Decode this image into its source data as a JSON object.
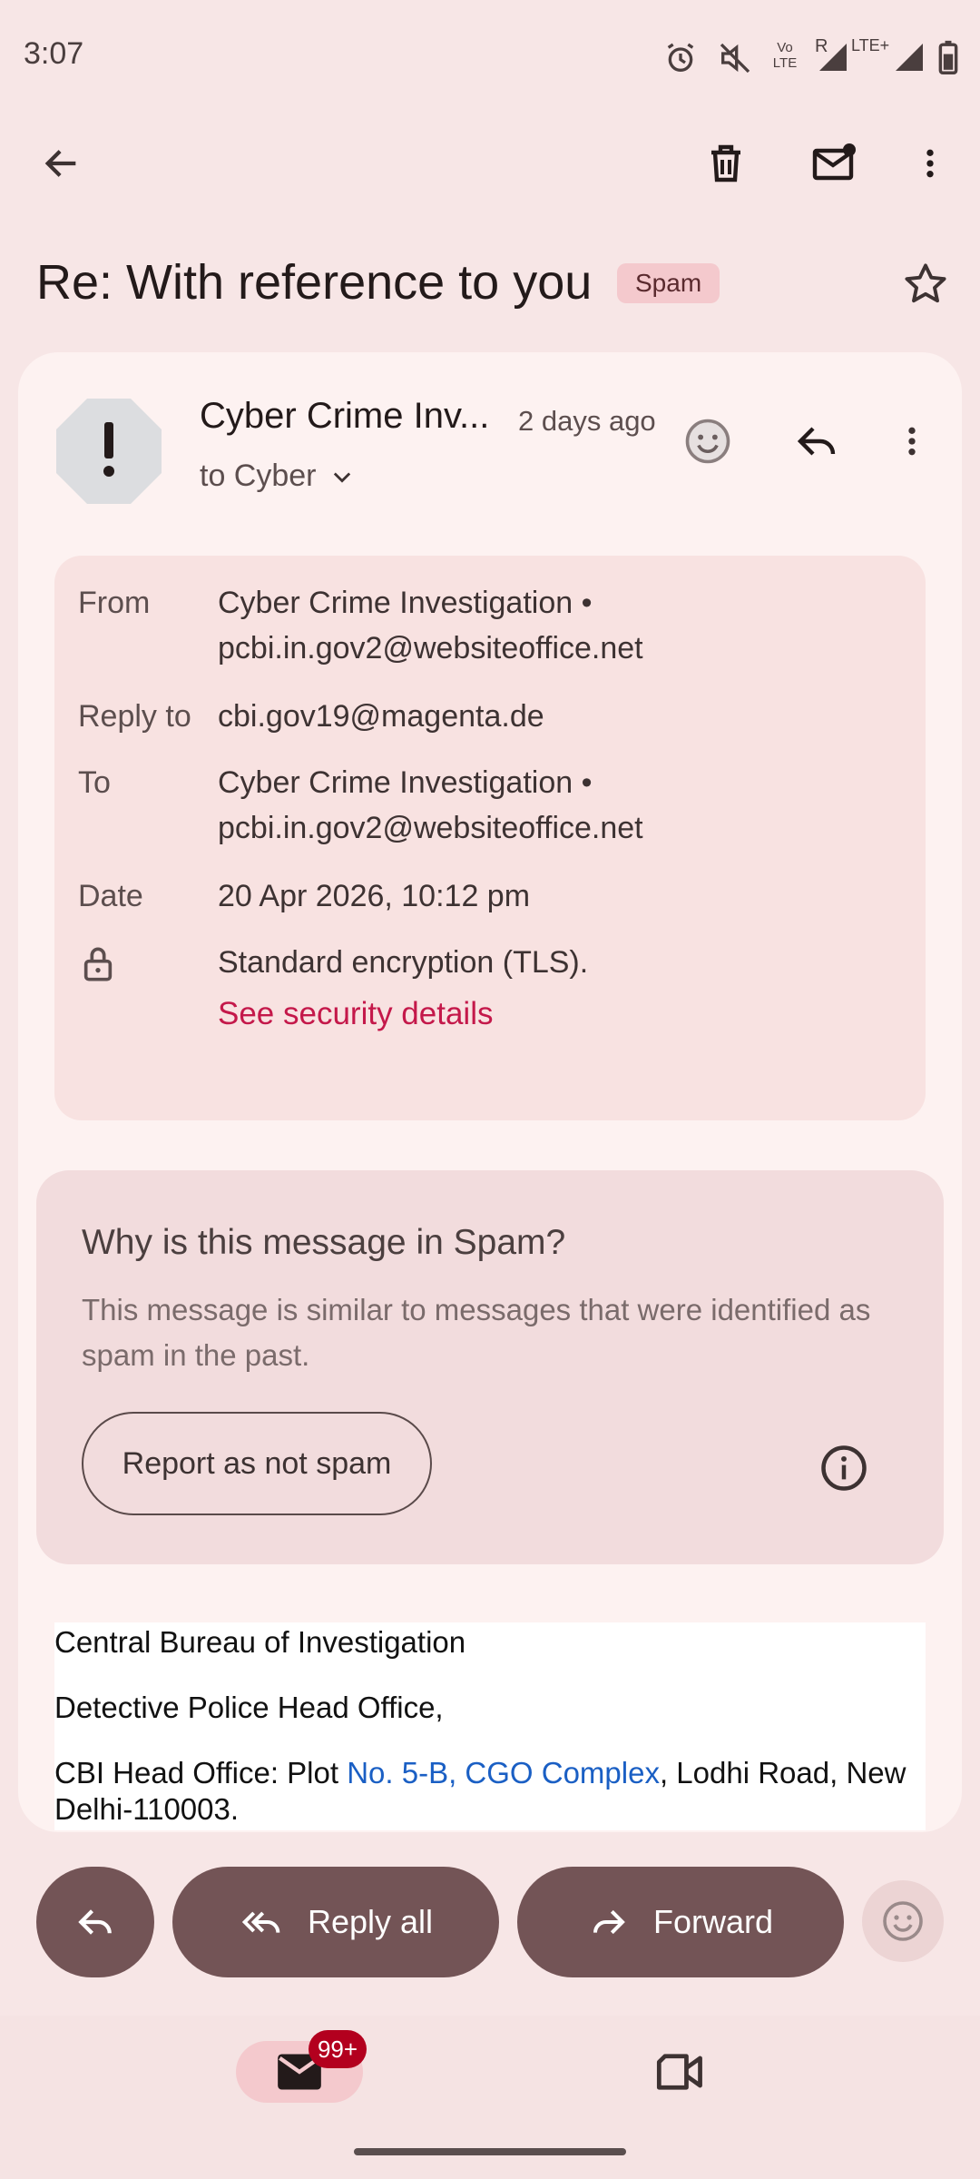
{
  "status_bar": {
    "time": "3:07",
    "network": "LTE+",
    "volte": "Vo LTE",
    "roaming": "R"
  },
  "toolbar": {
    "back": "arrow-left-icon",
    "delete": "trash-icon",
    "mark_unread": "mail-unread-icon",
    "more": "more-vert-icon"
  },
  "subject": {
    "text": "Re: With reference to you",
    "label": "Spam"
  },
  "message": {
    "sender_name": "Cyber Crime Inv...",
    "time": "2 days ago",
    "to": "to Cyber"
  },
  "details": {
    "from_label": "From",
    "from_name": "Cyber Crime Investigation •",
    "from_email": "pcbi.in.gov2@websiteoffice.net",
    "reply_to_label": "Reply to",
    "reply_to": "cbi.gov19@magenta.de",
    "to_label": "To",
    "to_name": "Cyber Crime Investigation •",
    "to_email": "pcbi.in.gov2@websiteoffice.net",
    "date_label": "Date",
    "date": "20 Apr 2026, 10:12 pm",
    "encryption": "Standard encryption (TLS).",
    "security_link": "See security details"
  },
  "spam_info": {
    "title": "Why is this message in Spam?",
    "description": "This message is similar to messages that were identified as spam in the past.",
    "button": "Report as not spam"
  },
  "body": {
    "line1": "Central Bureau of Investigation",
    "line2": "Detective Police Head Office,",
    "line3_pre": "CBI Head Office: Plot ",
    "line3_link": "No. 5-B, CGO Complex",
    "line3_post": ", Lodhi Road, New",
    "line4": "Delhi-110003."
  },
  "actions": {
    "reply_all": "Reply all",
    "forward": "Forward"
  },
  "nav": {
    "mail_badge": "99+"
  },
  "colors": {
    "accent": "#735456",
    "link_red": "#c4184a",
    "link_blue": "#1a5fc4",
    "badge": "#b3001e"
  }
}
